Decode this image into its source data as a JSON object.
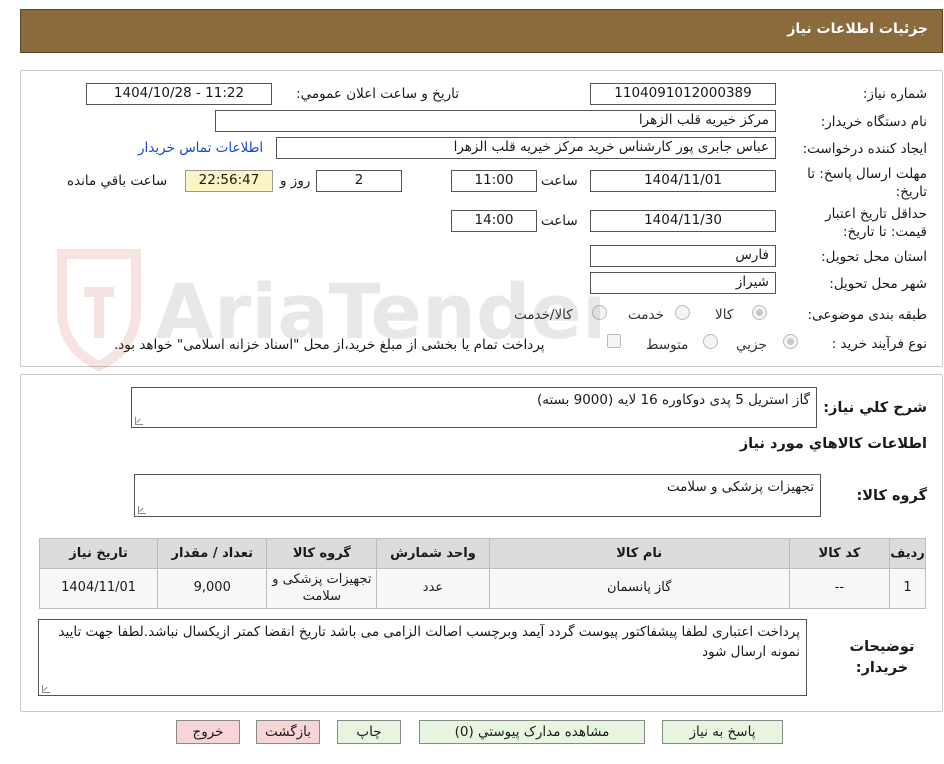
{
  "header": {
    "title": "جزئیات اطلاعات نیاز"
  },
  "form": {
    "need_number": {
      "label": "شماره نیاز:",
      "value": "1104091012000389"
    },
    "announce": {
      "label": "تاریخ و ساعت اعلان عمومي:",
      "value": "1404/10/28 - 11:22"
    },
    "buyer_org": {
      "label": "نام دستگاه خريدار:",
      "value": "مرکز خیریه قلب الزهرا"
    },
    "requester": {
      "label": "ايجاد کننده درخواست:",
      "value": "عباس جابری پور کارشناس خرید مرکز خیریه قلب الزهرا"
    },
    "contact_link": "اطلاعات تماس خريدار",
    "deadline": {
      "label": "مهلت ارسال پاسخ: تا تاریخ:",
      "date": "1404/11/01",
      "time_label": "ساعت",
      "time": "11:00",
      "days": "2",
      "days_label": "روز و",
      "remaining": "22:56:47",
      "remaining_label": "ساعت باقي مانده"
    },
    "validity": {
      "label": "حداقل تاريخ اعتبار قيمت: تا تاريخ:",
      "date": "1404/11/30",
      "time_label": "ساعت",
      "time": "14:00"
    },
    "province": {
      "label": "استان محل تحويل:",
      "value": "فارس"
    },
    "city": {
      "label": "شهر محل تحويل:",
      "value": "شیراز"
    },
    "category": {
      "label": "طبقه بندی موضوعی:",
      "options": [
        "کالا",
        "خدمت",
        "کالا/خدمت"
      ],
      "selected": "کالا"
    },
    "process": {
      "label": "نوع فرآیند خرید :",
      "options": [
        "جزيي",
        "متوسط"
      ],
      "selected": "جزيي",
      "note": "پرداخت تمام یا بخشی از مبلغ خرید،از محل \"اسناد خزانه اسلامی\" خواهد بود."
    }
  },
  "summary": {
    "label": "شرح کلي نياز:",
    "value": "گاز استریل 5 پدی دوکاوره 16 لایه (9000 بسته)",
    "goods_title": "اطلاعات کالاهاي مورد نياز",
    "group_label": "گروه کالا:",
    "group_value": "تجهیزات پزشکی و سلامت"
  },
  "table": {
    "headers": [
      "رديف",
      "کد کالا",
      "نام کالا",
      "واحد شمارش",
      "گروه کالا",
      "تعداد / مقدار",
      "تاريخ نياز"
    ],
    "rows": [
      [
        "1",
        "--",
        "گاز پانسمان",
        "عدد",
        "تجهیزات پزشکی و سلامت",
        "9,000",
        "1404/11/01"
      ]
    ]
  },
  "notes": {
    "label": "توضيحات خريدار:",
    "value": "پرداخت اعتباری لطفا پیشفاکتور پیوست گردد آیمد وبرچسب اصالت الزامی می باشد تاریخ انقضا کمتر ازیکسال نباشد.لطفا جهت تایید نمونه ارسال شود"
  },
  "buttons": {
    "reply": "پاسخ به نياز",
    "attachments": "مشاهده مدارک پيوستي (0)",
    "print": "چاپ",
    "back": "بازگشت",
    "exit": "خروج"
  },
  "colors": {
    "header_bg": "#8b6a3c",
    "link": "#1a47c9",
    "remaining_bg": "#fbf5c5"
  }
}
